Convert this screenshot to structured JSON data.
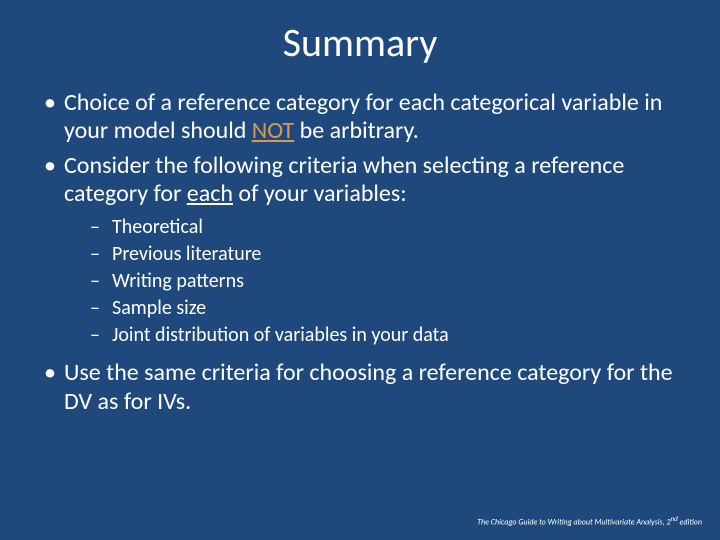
{
  "title": "Summary",
  "b1_a": "Choice of a reference category for each categorical variable in your model should ",
  "b1_not": "NOT",
  "b1_b": " be arbitrary.",
  "b2_a": "Consider the following criteria when selecting a reference category for ",
  "b2_each": "each",
  "b2_b": " of your variables:",
  "sub": [
    "Theoretical",
    "Previous literature",
    "Writing patterns",
    "Sample size",
    "Joint distribution of variables in your data"
  ],
  "b3": "Use the same criteria for choosing a reference category for the DV as for IVs.",
  "footer_a": "The Chicago Guide to Writing about Multivariate Analysis, 2",
  "footer_sup": "nd",
  "footer_b": " edition"
}
